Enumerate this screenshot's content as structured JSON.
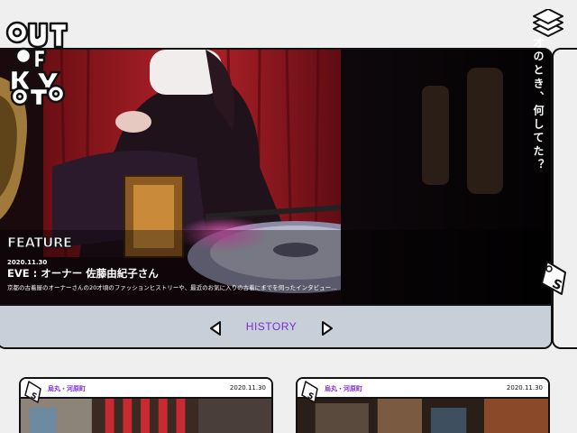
{
  "brand": {
    "name": "OUT OF KYOTO"
  },
  "hero": {
    "badge": "FEATURE",
    "date": "2020.11.30",
    "title": "EVE : オーナー 佐藤由紀子さん",
    "description": "京都の古着屋のオーナーさんの20才頃のファッションヒストリーや、最近のお気に入りの古着にまでを伺ったインタビュー…",
    "vertical_text": "20才のとき、何してた？"
  },
  "nav": {
    "history_label": "HISTORY"
  },
  "cards": [
    {
      "location": "烏丸・河原町",
      "date": "2020.11.30"
    },
    {
      "location": "烏丸・河原町",
      "date": "2020.11.30"
    }
  ],
  "colors": {
    "accent": "#7b2bd6",
    "nav_bg": "#c7d0d8",
    "page_bg": "#efefef",
    "outline": "#111111"
  },
  "icons": {
    "menu": "layers-stack-icon",
    "prev": "triangle-left-icon",
    "next": "triangle-right-icon",
    "tag": "s-tag-icon"
  }
}
